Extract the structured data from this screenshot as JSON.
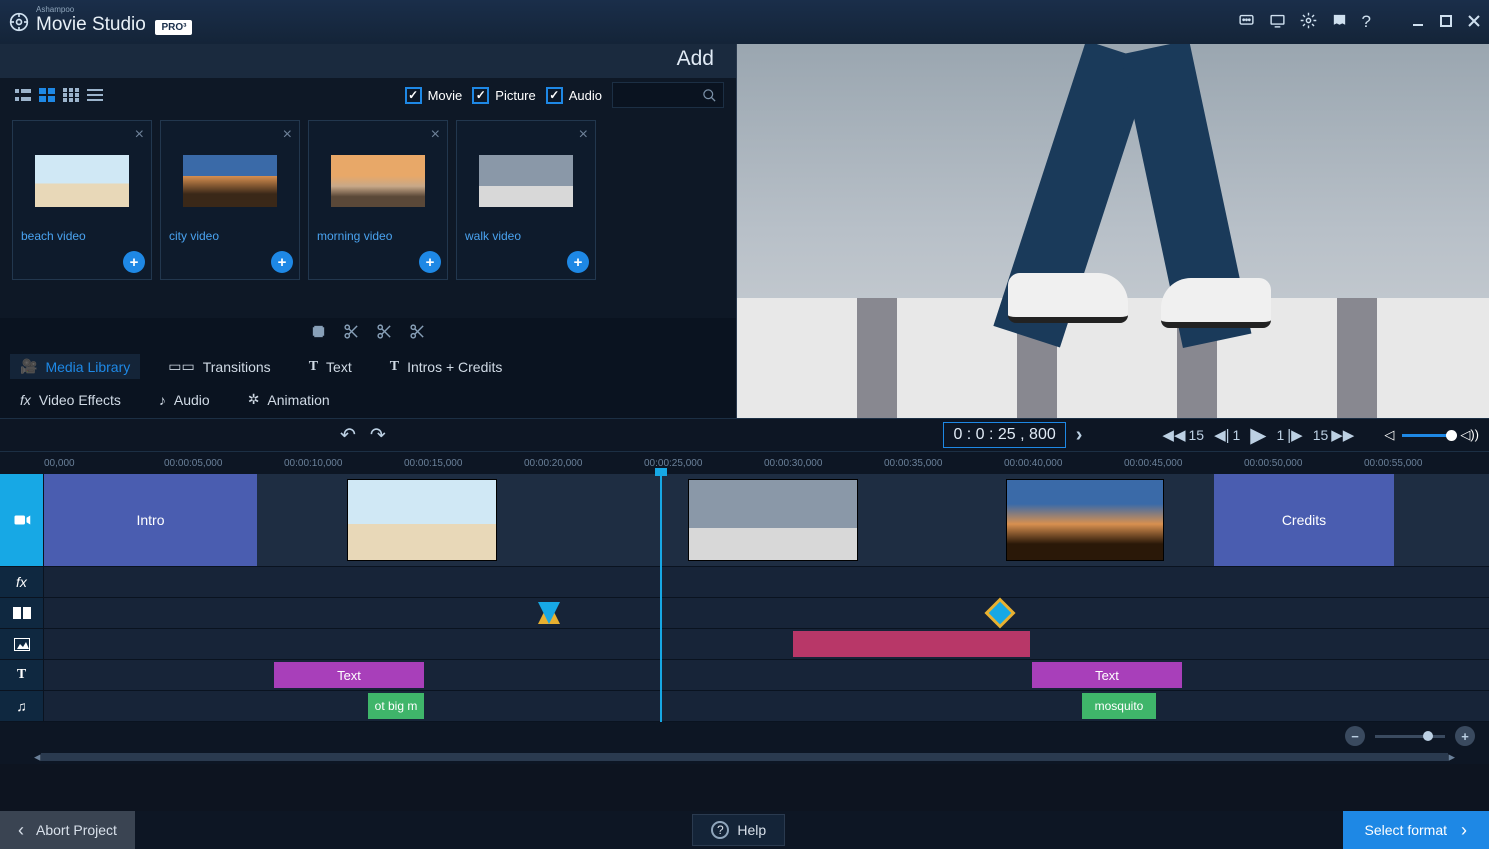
{
  "title": {
    "vendor": "Ashampoo",
    "app": "Movie Studio",
    "badge": "PRO³"
  },
  "panel": {
    "title": "Add"
  },
  "filters": {
    "movie": "Movie",
    "picture": "Picture",
    "audio": "Audio"
  },
  "media": [
    {
      "label": "beach video",
      "thumb": "beach"
    },
    {
      "label": "city video",
      "thumb": "city"
    },
    {
      "label": "morning video",
      "thumb": "morning"
    },
    {
      "label": "walk video",
      "thumb": "walk"
    }
  ],
  "tabs": [
    {
      "icon": "🎥",
      "label": "Media Library",
      "active": true
    },
    {
      "icon": "▭▭",
      "label": "Transitions"
    },
    {
      "icon": "T",
      "label": "Text"
    },
    {
      "icon": "T",
      "label": "Intros + Credits"
    },
    {
      "icon": "fx",
      "label": "Video Effects"
    },
    {
      "icon": "♪",
      "label": "Audio"
    },
    {
      "icon": "✲",
      "label": "Animation"
    }
  ],
  "transport": {
    "timecode": "0  :  0  :  25  ,  800",
    "rewind": "15",
    "prev": "1",
    "next": "1",
    "fwd": "15"
  },
  "ruler": [
    "00,000",
    "00:00:05,000",
    "00:00:10,000",
    "00:00:15,000",
    "00:00:20,000",
    "00:00:25,000",
    "00:00:30,000",
    "00:00:35,000",
    "00:00:40,000",
    "00:00:45,000",
    "00:00:50,000",
    "00:00:55,000"
  ],
  "clips": {
    "intro": "Intro",
    "credits": "Credits",
    "text1": "Text",
    "text2": "Text",
    "audio1": "ot big m",
    "audio2": "mosquito"
  },
  "bottom": {
    "abort": "Abort Project",
    "help": "Help",
    "format": "Select format"
  }
}
